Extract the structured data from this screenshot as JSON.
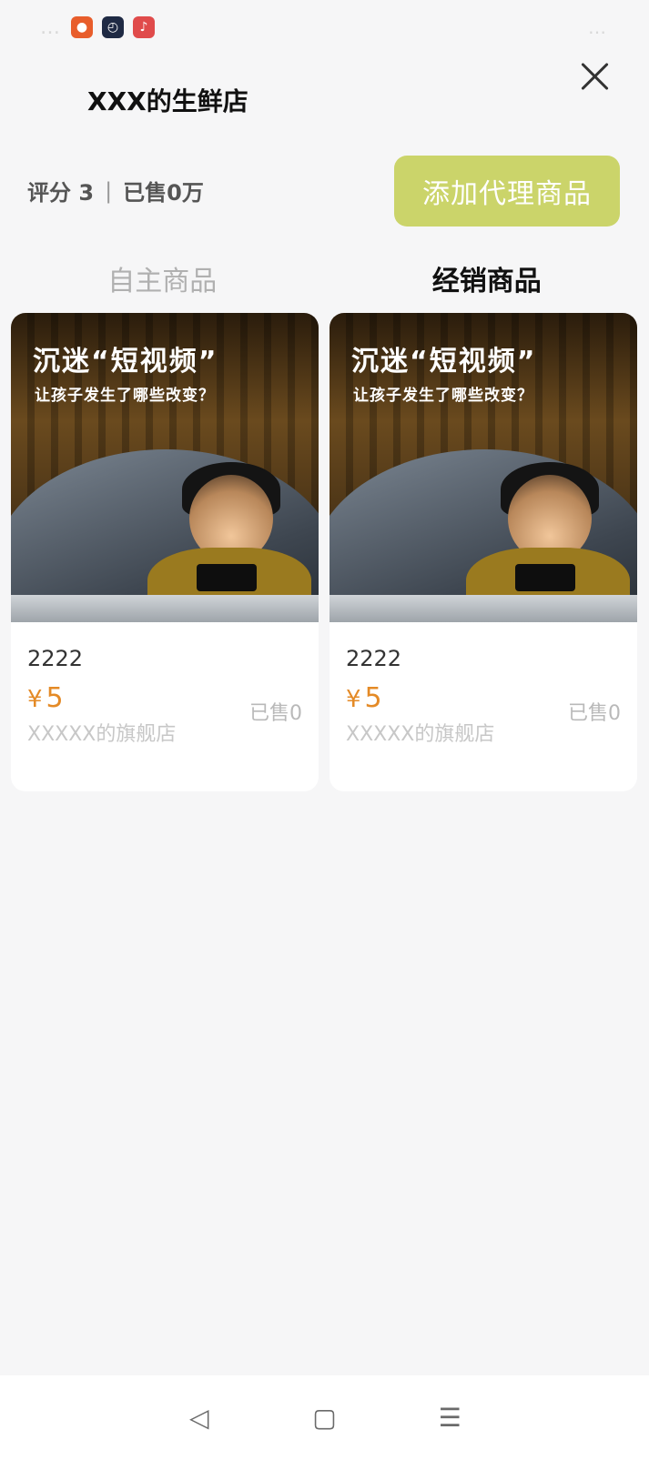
{
  "status_bar": {
    "left_blur": "…",
    "right_blur": "…"
  },
  "header": {
    "shop_name": "XXX的生鲜店"
  },
  "stats": {
    "rating_label": "评分 3",
    "separator": "|",
    "sold_label": "已售0万"
  },
  "actions": {
    "add_proxy_label": "添加代理商品",
    "add_proxy_color": "#cbd46a"
  },
  "tabs": [
    {
      "label": "自主商品",
      "active": false
    },
    {
      "label": "经销商品",
      "active": true
    }
  ],
  "products": [
    {
      "promo_title": "沉迷“短视频”",
      "promo_sub": "让孩子发生了哪些改变？",
      "name": "2222",
      "price_symbol": "¥",
      "price": "5",
      "sold": "已售0",
      "store": "XXXXX的旗舰店"
    },
    {
      "promo_title": "沉迷“短视频”",
      "promo_sub": "让孩子发生了哪些改变？",
      "name": "2222",
      "price_symbol": "¥",
      "price": "5",
      "sold": "已售0",
      "store": "XXXXX的旗舰店"
    }
  ],
  "nav": {
    "back_icon": "◁",
    "home_icon": "▢",
    "menu_icon": "☰"
  },
  "colors": {
    "price": "#e48a26",
    "accent": "#cbd46a"
  }
}
